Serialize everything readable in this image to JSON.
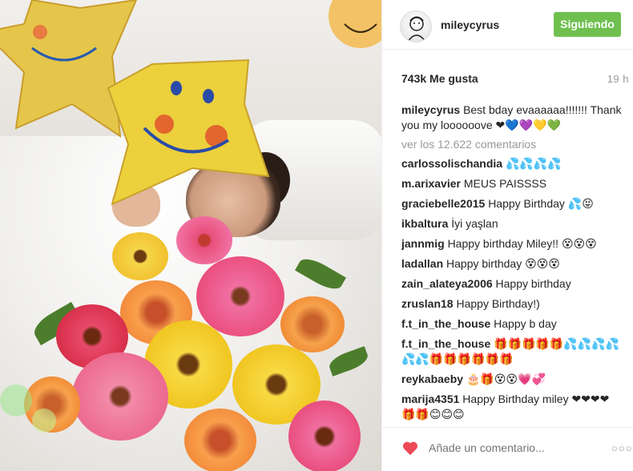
{
  "post": {
    "username": "mileycyrus",
    "follow_label": "Siguiendo",
    "likes": "743k Me gusta",
    "time": "19 h",
    "caption": {
      "user": "mileycyrus",
      "text": "Best bday evaaaaaa!!!!!!! Thank you my loooooove ❤💙💜💛💚"
    },
    "view_all": "ver los 12.622 comentarios",
    "comments": [
      {
        "user": "carlossolischandia",
        "text": "💦💦💦💦"
      },
      {
        "user": "m.arixavier",
        "text": "MEUS PAISSSS"
      },
      {
        "user": "graciebelle2015",
        "text": "Happy Birthday 💦😝"
      },
      {
        "user": "ikbaltura",
        "text": "İyi yaşlan"
      },
      {
        "user": "jannmig",
        "text": "Happy birthday Miley!! 😵😵😵"
      },
      {
        "user": "ladallan",
        "text": "Happy birthday 😵😵😵"
      },
      {
        "user": "zain_alateya2006",
        "text": "Happy birthday"
      },
      {
        "user": "zruslan18",
        "text": "Happy Birthday!)"
      },
      {
        "user": "f.t_in_the_house",
        "text": "Happy b day"
      },
      {
        "user": "f.t_in_the_house",
        "text": "🎁🎁🎁🎁🎁💦💦💦💦💦💦🎁🎁🎁🎁🎁🎁"
      },
      {
        "user": "reykabaeby",
        "text": "🎂🎁😵😵💗💞"
      },
      {
        "user": "marija4351",
        "text": "Happy Birthday miley ❤❤❤❤🎁🎁😊😊😊"
      }
    ],
    "add_comment_placeholder": "Añade un comentario...",
    "more_label": "○○○"
  },
  "icons": {
    "like": "heart-icon",
    "more": "more-options-icon"
  },
  "colors": {
    "follow_button": "#70c050",
    "heart": "#ed4956",
    "muted_text": "#999999"
  }
}
